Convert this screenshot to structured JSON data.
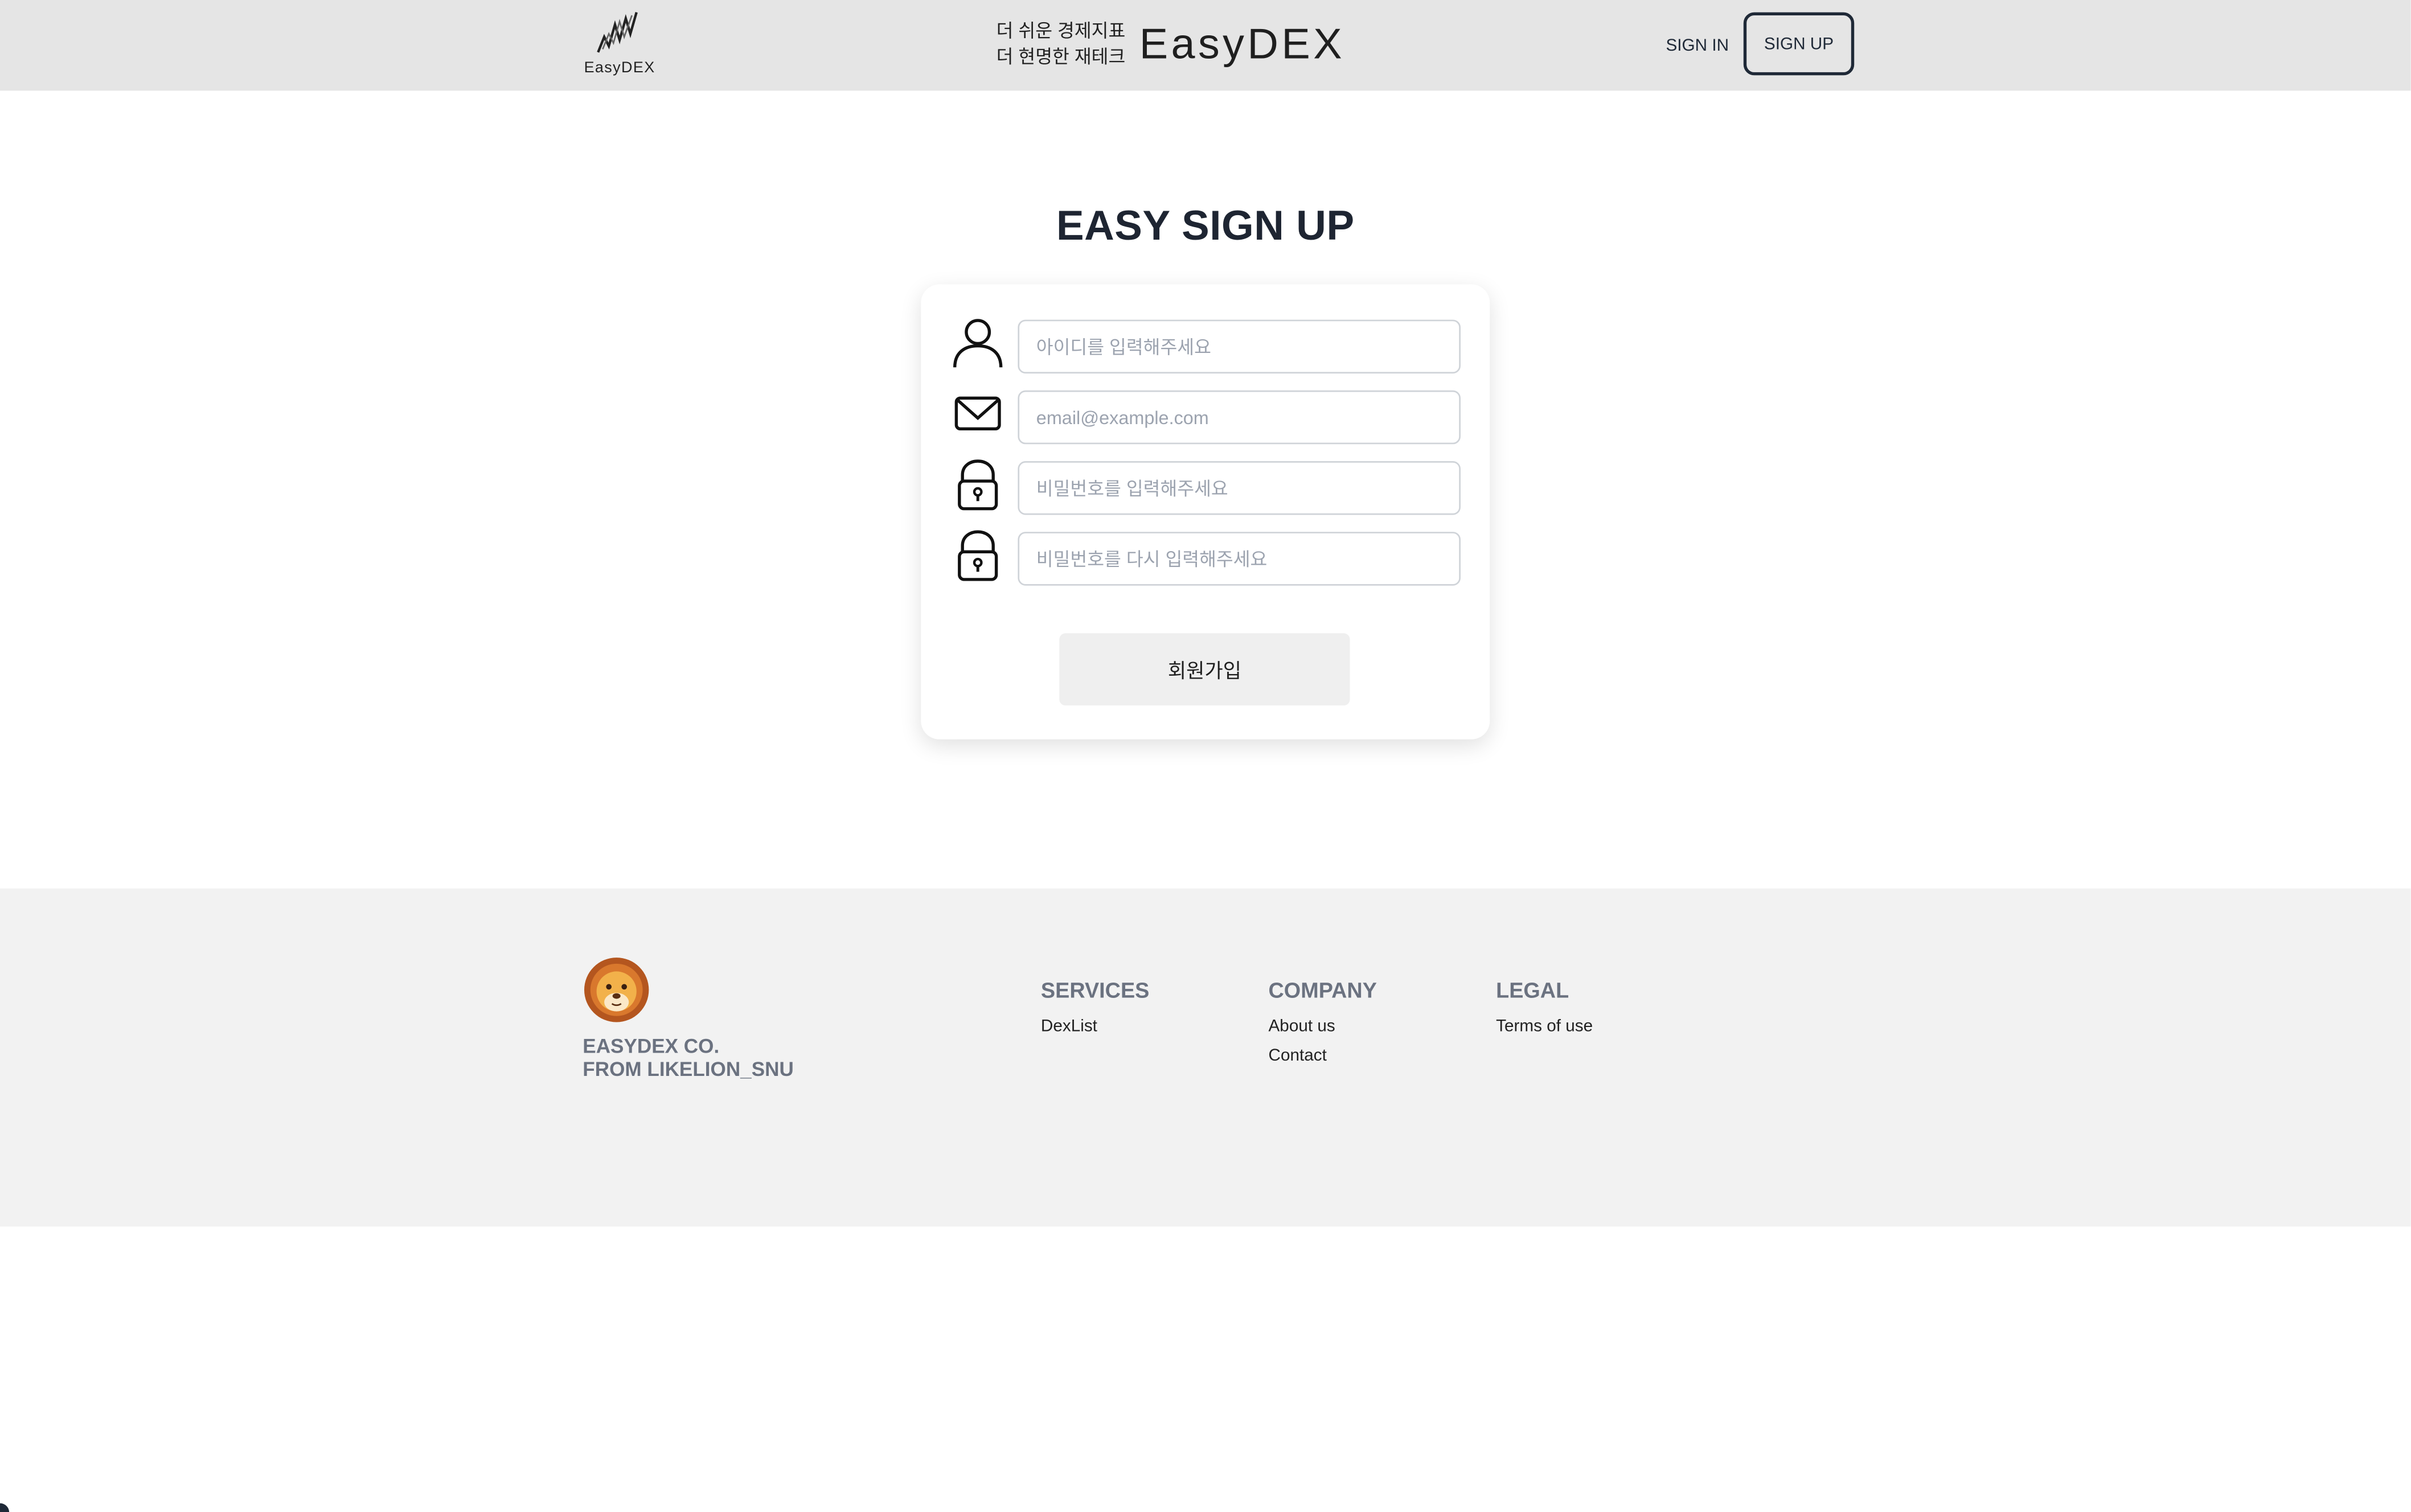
{
  "header": {
    "logo_text": "EasyDEX",
    "tagline_line1": "더 쉬운 경제지표",
    "tagline_line2": "더 현명한 재테크",
    "brand": "EasyDEX",
    "signin_label": "SIGN IN",
    "signup_label": "SIGN UP"
  },
  "form": {
    "title": "EASY SIGN UP",
    "id_placeholder": "아이디를 입력해주세요",
    "email_placeholder": "email@example.com",
    "password_placeholder": "비밀번호를 입력해주세요",
    "password_confirm_placeholder": "비밀번호를 다시 입력해주세요",
    "submit_label": "회원가입",
    "icons": [
      "user-icon",
      "mail-icon",
      "lock-icon",
      "lock-icon"
    ]
  },
  "footer": {
    "company_line1": "EASYDEX CO.",
    "company_line2": "FROM LIKELION_SNU",
    "services": {
      "title": "SERVICES",
      "links": [
        "DexList"
      ]
    },
    "company": {
      "title": "COMPANY",
      "links": [
        "About us",
        "Contact"
      ]
    },
    "legal": {
      "title": "LEGAL",
      "links": [
        "Terms of use"
      ]
    }
  }
}
